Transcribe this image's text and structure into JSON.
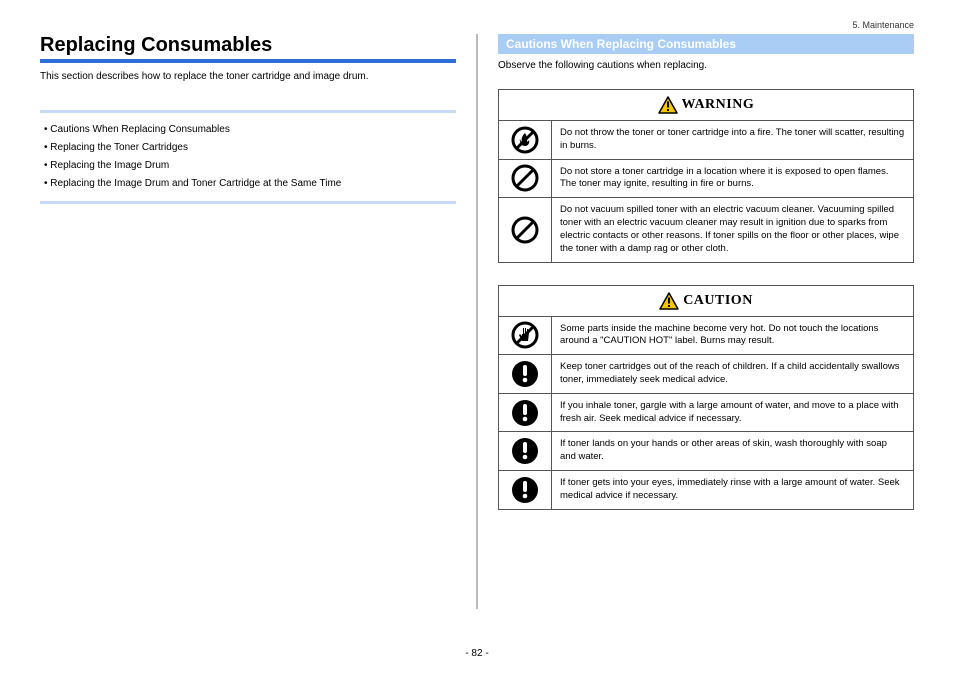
{
  "header": {
    "chapter": "5. Maintenance"
  },
  "left": {
    "title": "Replacing Consumables",
    "intro": "This section describes how to replace the toner cartridge and image drum.",
    "toc": [
      "Cautions When Replacing Consumables",
      "Replacing the Toner Cartridges",
      "Replacing the Image Drum",
      "Replacing the Image Drum and Toner Cartridge at the Same Time"
    ]
  },
  "right": {
    "section_title": "Cautions When Replacing Consumables",
    "note": "Observe the following cautions when replacing.",
    "warning": {
      "label": "WARNING",
      "rows": [
        {
          "icon": "fire-prohibit",
          "text": "Do not throw the toner or toner cartridge into a fire. The toner will scatter, resulting in burns."
        },
        {
          "icon": "prohibit",
          "text": "Do not store a toner cartridge in a location where it is exposed to open flames. The toner may ignite, resulting in fire or burns."
        },
        {
          "icon": "prohibit",
          "text": "Do not vacuum spilled toner with an electric vacuum cleaner. Vacuuming spilled toner with an electric vacuum cleaner may result in ignition due to sparks from electric contacts or other reasons. If toner spills on the floor or other places, wipe the toner with a damp rag or other cloth."
        }
      ]
    },
    "caution": {
      "label": "CAUTION",
      "rows": [
        {
          "icon": "hand-prohibit",
          "text": "Some parts inside the machine become very hot. Do not touch the locations around a \"CAUTION HOT\" label. Burns may result."
        },
        {
          "icon": "exclaim",
          "text": "Keep toner cartridges out of the reach of children. If a child accidentally swallows toner, immediately seek medical advice."
        },
        {
          "icon": "exclaim",
          "text": "If you inhale toner, gargle with a large amount of water, and move to a place with fresh air. Seek medical advice if necessary."
        },
        {
          "icon": "exclaim",
          "text": "If toner lands on your hands or other areas of skin, wash thoroughly with soap and water."
        },
        {
          "icon": "exclaim",
          "text": "If toner gets into your eyes, immediately rinse with a large amount of water. Seek medical advice if necessary."
        }
      ]
    }
  },
  "footer": {
    "page": "- 82 -"
  }
}
